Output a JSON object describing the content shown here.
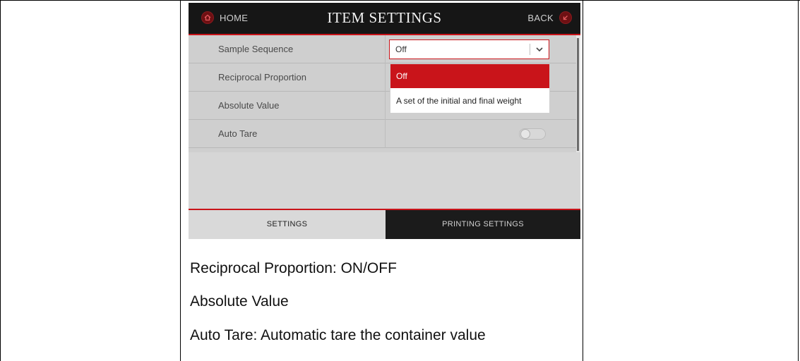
{
  "device": {
    "header": {
      "home_label": "HOME",
      "title": "ITEM SETTINGS",
      "back_label": "BACK"
    },
    "settings_rows": [
      {
        "label": "Sample Sequence",
        "control": "select",
        "value": "Off"
      },
      {
        "label": "Reciprocal Proportion"
      },
      {
        "label": "Absolute Value"
      },
      {
        "label": "Auto Tare",
        "control": "toggle",
        "state": "off"
      }
    ],
    "dropdown": {
      "options": [
        {
          "label": "Off",
          "selected": true
        },
        {
          "label": "A set of the initial and final weight",
          "selected": false
        }
      ]
    },
    "tabs": [
      {
        "label": "SETTINGS",
        "active": true
      },
      {
        "label": "PRINTING SETTINGS",
        "active": false
      }
    ]
  },
  "descriptions": [
    "Reciprocal Proportion: ON/OFF",
    "Absolute Value",
    "Auto Tare: Automatic tare the container value"
  ],
  "colors": {
    "accent": "#c9141a",
    "header_bg": "#161616",
    "tab_dark": "#1b1b1b"
  },
  "icons": {
    "home": "home-icon",
    "back": "back-arrow-icon",
    "dropdown": "chevron-down-icon"
  }
}
